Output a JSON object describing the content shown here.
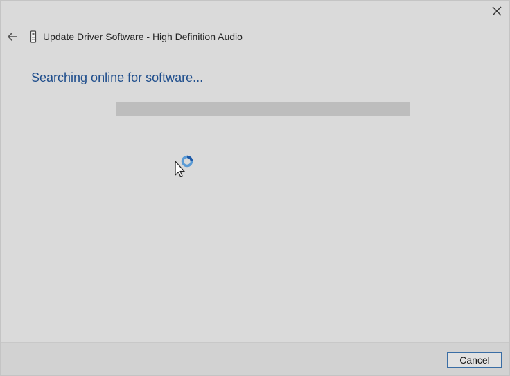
{
  "window": {
    "title": "Update Driver Software - High Definition Audio",
    "close_icon": "close-icon",
    "back_icon": "back-arrow-icon",
    "device_icon": "audio-device-icon"
  },
  "main": {
    "heading": "Searching online for software...",
    "progress": {
      "value_percent": 0,
      "track_color": "#bdbdbd"
    }
  },
  "footer": {
    "cancel_label": "Cancel"
  },
  "colors": {
    "heading": "#1f4e8c",
    "dialog_bg": "#dadada",
    "button_border": "#3a6ea5"
  }
}
